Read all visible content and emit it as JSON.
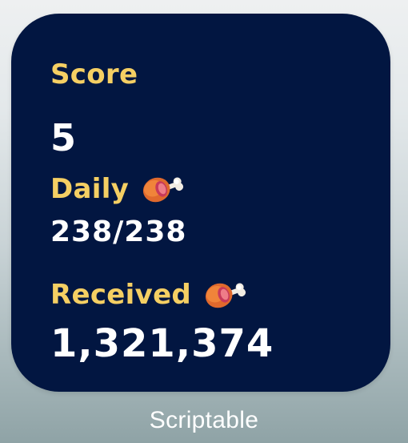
{
  "widget": {
    "score_label": "Score",
    "score_value": "5",
    "daily_label": "Daily",
    "daily_value": "238/238",
    "received_label": "Received",
    "received_value": "1,321,374",
    "daily_icon": "meat-on-bone-icon",
    "received_icon": "meat-on-bone-icon"
  },
  "app": {
    "name": "Scriptable"
  },
  "colors": {
    "widget_background": "#021641",
    "label": "#f5cf63",
    "value": "#ffffff"
  }
}
